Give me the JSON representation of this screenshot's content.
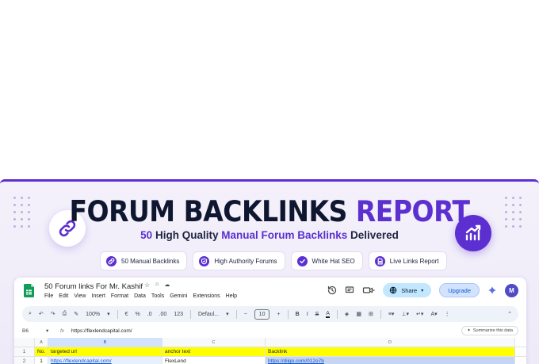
{
  "banner": {
    "title_main": "FORUM BACKLINKS",
    "title_accent": "REPORT",
    "subtitle_count": "50",
    "subtitle_pre": "High Quality",
    "subtitle_highlight": "Manual Forum Backlinks",
    "subtitle_post": "Delivered",
    "features": [
      {
        "label": "50 Manual Backlinks",
        "icon": "link-icon"
      },
      {
        "label": "High Authority Forums",
        "icon": "shield-icon"
      },
      {
        "label": "White Hat SEO",
        "icon": "check-icon"
      },
      {
        "label": "Live Links Report",
        "icon": "document-icon"
      }
    ],
    "accent_color": "#5b2fd0"
  },
  "sheet": {
    "title": "50 Forum links For Mr. Kashif",
    "menu": [
      "File",
      "Edit",
      "View",
      "Insert",
      "Format",
      "Data",
      "Tools",
      "Gemini",
      "Extensions",
      "Help"
    ],
    "share_label": "Share",
    "upgrade_label": "Upgrade",
    "avatar_letter": "M",
    "toolbar": {
      "zoom": "100%",
      "currency": "€",
      "percent": "%",
      "dec_dec": ".0",
      "dec_inc": ".00",
      "number_format": "123",
      "font": "Defaul...",
      "font_size": "10"
    },
    "cell_ref": "B6",
    "fx": "fx",
    "formula_value": "https://flexlendcapital.com/",
    "summarize_label": "Summarize this data",
    "columns": [
      "A",
      "B",
      "C",
      "D"
    ],
    "rows": [
      {
        "num": "1",
        "a": "No.",
        "b": "targeted url",
        "c": "anchor text",
        "d": "Backlink"
      },
      {
        "num": "2",
        "a": "1",
        "b": "https://flexlendcapital.com/",
        "c": "FlexLend",
        "d": "https://diigo.com/012o7b"
      }
    ]
  }
}
